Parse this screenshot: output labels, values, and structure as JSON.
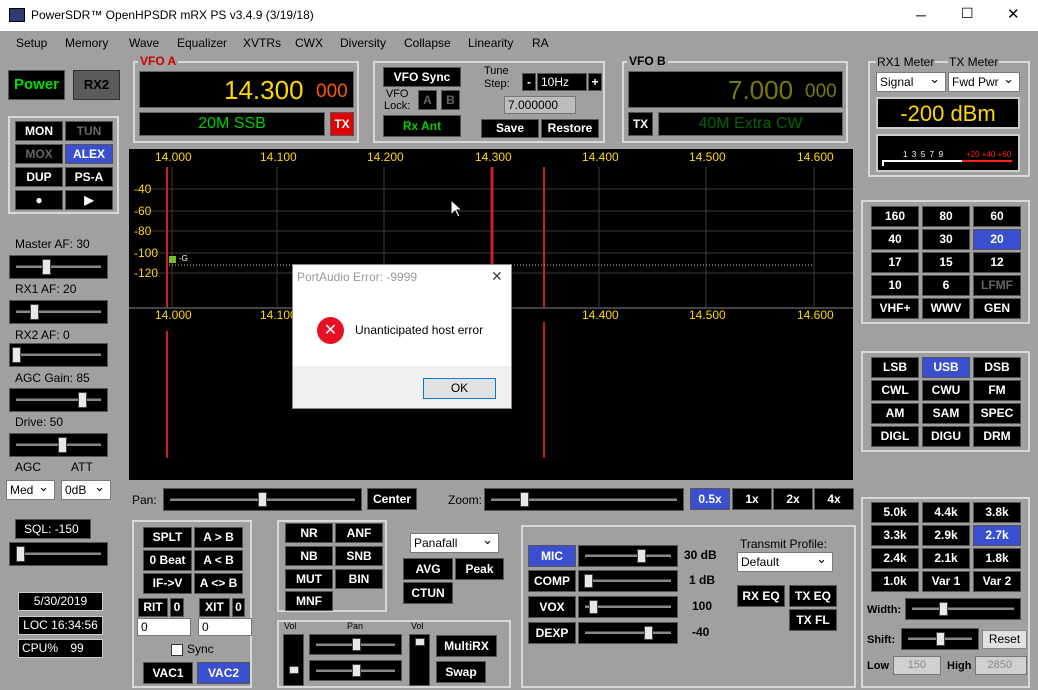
{
  "app_title": "PowerSDR™ OpenHPSDR mRX PS v3.4.9 (3/19/18)",
  "menu": [
    "Setup",
    "Memory",
    "Wave",
    "Equalizer",
    "XVTRs",
    "CWX",
    "Diversity",
    "Collapse",
    "Linearity",
    "RA"
  ],
  "power": {
    "power": "Power",
    "rx2": "RX2"
  },
  "ctrl_buttons": [
    "MON",
    "TUN",
    "MOX",
    "ALEX",
    "DUP",
    "PS-A",
    "●",
    "▶"
  ],
  "vfo_a": {
    "title": "VFO A",
    "freq": "14.300",
    "sub": "000",
    "band": "20M SSB",
    "tx": "TX"
  },
  "vfo_b": {
    "title": "VFO B",
    "freq": "7.000",
    "sub": "000",
    "band": "40M Extra CW",
    "tx": "TX"
  },
  "vfo_sync": "VFO Sync",
  "vfo_lock": "VFO\nLock:",
  "lock_a": "A",
  "lock_b": "B",
  "rx_ant": "Rx Ant",
  "tune_step": {
    "label": "Tune\nStep:",
    "minus": "-",
    "value": "10Hz",
    "plus": "+",
    "freq": "7.000000"
  },
  "save": "Save",
  "restore": "Restore",
  "meters": {
    "rx1_label": "RX1 Meter",
    "tx_label": "TX Meter",
    "rx1_sel": "Signal",
    "tx_sel": "Fwd Pwr",
    "reading": "-200 dBm",
    "scale": "1  3  5  7  9",
    "scale_red": "+20 +40 +60"
  },
  "spectrum": {
    "freqs": [
      "14.000",
      "14.100",
      "14.200",
      "14.300",
      "14.400",
      "14.500",
      "14.600"
    ],
    "dbm": [
      "-40",
      "-60",
      "-80",
      "-100",
      "-120"
    ],
    "marker": "-G"
  },
  "dialog": {
    "title": "PortAudio Error: -9999",
    "message": "Unanticipated host error",
    "ok": "OK",
    "close": "✕"
  },
  "left_sliders": {
    "master": "Master AF:  30",
    "rx1": "RX1 AF:  20",
    "rx2": "RX2 AF:  0",
    "agc_gain": "AGC Gain:  85",
    "drive": "Drive:  50"
  },
  "agc": {
    "agc_label": "AGC",
    "att_label": "ATT",
    "agc_val": "Med",
    "att_val": "0dB"
  },
  "sql": "SQL:  -150",
  "status": {
    "date": "5/30/2019",
    "loc": "LOC 16:34:56",
    "cpu_label": "CPU%",
    "cpu": "99"
  },
  "pan": {
    "pan_label": "Pan:",
    "center": "Center",
    "zoom_label": "Zoom:",
    "zooms": [
      "0.5x",
      "1x",
      "2x",
      "4x"
    ]
  },
  "split": [
    "SPLT",
    "A > B",
    "0 Beat",
    "A < B",
    "IF->V",
    "A <> B"
  ],
  "rit": {
    "rit": "RIT",
    "rit_val": "0",
    "xit": "XIT",
    "xit_val": "0",
    "rit_num": "0",
    "xit_num": "0"
  },
  "sync": "Sync",
  "vac1": "VAC1",
  "vac2": "VAC2",
  "dsp": [
    "NR",
    "ANF",
    "NB",
    "SNB",
    "MUT",
    "BIN",
    "MNF"
  ],
  "display_mode": "Panafall",
  "avg": "AVG",
  "peak": "Peak",
  "ctun": "CTUN",
  "mix": {
    "vol1": "Vol",
    "pan": "Pan",
    "vol2": "Vol",
    "multirx": "MultiRX",
    "swap": "Swap"
  },
  "tx": {
    "mic": "MIC",
    "mic_val": "30 dB",
    "comp": "COMP",
    "comp_val": "1 dB",
    "vox": "VOX",
    "vox_val": "100",
    "dexp": "DEXP",
    "dexp_val": "-40",
    "profile_label": "Transmit Profile:",
    "profile": "Default",
    "rx_eq": "RX EQ",
    "tx_eq": "TX EQ",
    "tx_fl": "TX FL"
  },
  "bands": [
    "160",
    "80",
    "60",
    "40",
    "30",
    "20",
    "17",
    "15",
    "12",
    "10",
    "6",
    "LFMF",
    "VHF+",
    "WWV",
    "GEN"
  ],
  "modes": [
    "LSB",
    "USB",
    "DSB",
    "CWL",
    "CWU",
    "FM",
    "AM",
    "SAM",
    "SPEC",
    "DIGL",
    "DIGU",
    "DRM"
  ],
  "filters": [
    "5.0k",
    "4.4k",
    "3.8k",
    "3.3k",
    "2.9k",
    "2.7k",
    "2.4k",
    "2.1k",
    "1.8k",
    "1.0k",
    "Var 1",
    "Var 2"
  ],
  "filter_ctrl": {
    "width": "Width:",
    "shift": "Shift:",
    "reset": "Reset",
    "low": "Low",
    "low_val": "150",
    "high": "High",
    "high_val": "2850"
  },
  "colors": {
    "accent": "#3a4fcf",
    "vfo_a": "#ffd700",
    "vfo_b": "#7a7a00",
    "band_green": "#00cc00",
    "red": "#cc0000"
  }
}
